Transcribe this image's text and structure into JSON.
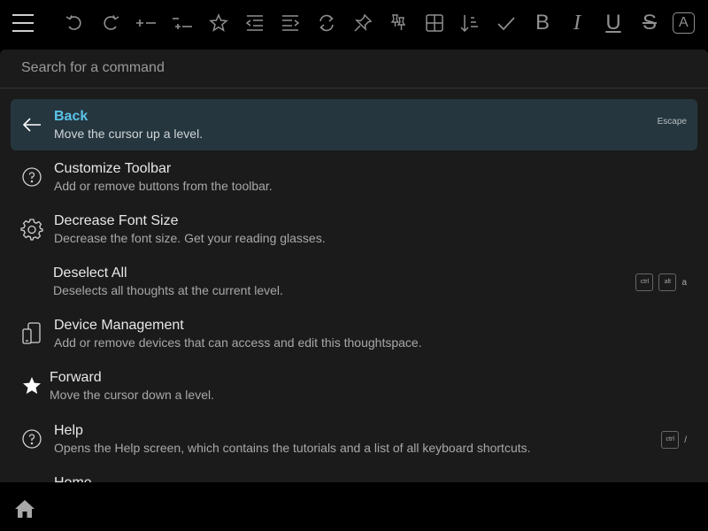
{
  "toolbar": {
    "menu_icon": "hamburger-menu-icon",
    "buttons": [
      {
        "name": "undo-icon"
      },
      {
        "name": "redo-icon"
      },
      {
        "name": "new-thought-icon"
      },
      {
        "name": "new-subthought-icon"
      },
      {
        "name": "favorite-star-icon"
      },
      {
        "name": "outdent-icon"
      },
      {
        "name": "indent-icon"
      },
      {
        "name": "swap-icon"
      },
      {
        "name": "pin-icon"
      },
      {
        "name": "pin-all-icon"
      },
      {
        "name": "table-view-icon"
      },
      {
        "name": "sort-icon"
      },
      {
        "name": "mark-done-icon"
      },
      {
        "name": "bold-icon",
        "glyph": "B"
      },
      {
        "name": "italic-icon",
        "glyph": "I"
      },
      {
        "name": "underline-icon",
        "glyph": "U"
      },
      {
        "name": "strikethrough-icon",
        "glyph": "S"
      },
      {
        "name": "text-color-icon",
        "glyph": "A"
      }
    ]
  },
  "search": {
    "placeholder": "Search for a command",
    "value": ""
  },
  "commands": [
    {
      "label": "Back",
      "description": "Move the cursor up a level.",
      "icon": "arrow-left-icon",
      "shortcut": {
        "text": "Escape"
      },
      "active": true
    },
    {
      "label": "Customize Toolbar",
      "description": "Add or remove buttons from the toolbar.",
      "icon": "question-circle-icon"
    },
    {
      "label": "Decrease Font Size",
      "description": "Decrease the font size. Get your reading glasses.",
      "icon": "gear-icon"
    },
    {
      "label": "Deselect All",
      "description": "Deselects all thoughts at the current level.",
      "icon": "",
      "shortcut": {
        "keys": [
          "ctrl",
          "alt"
        ],
        "key": "a"
      }
    },
    {
      "label": "Device Management",
      "description": "Add or remove devices that can access and edit this thoughtspace.",
      "icon": "devices-icon"
    },
    {
      "label": "Forward",
      "description": "Move the cursor down a level.",
      "icon": "star-icon"
    },
    {
      "label": "Help",
      "description": "Opens the Help screen, which contains the tutorials and a list of all keyboard shortcuts.",
      "icon": "question-circle-icon",
      "shortcut": {
        "keys": [
          "ctrl"
        ],
        "key": "/"
      }
    },
    {
      "label": "Home",
      "description": "",
      "icon": ""
    }
  ],
  "bottom": {
    "home_icon": "home-icon"
  },
  "colors": {
    "accent": "#5bc4ea",
    "active_row_bg": "#26363e",
    "panel_bg": "#1b1b1b",
    "icon_gray": "#8f8f8f"
  }
}
